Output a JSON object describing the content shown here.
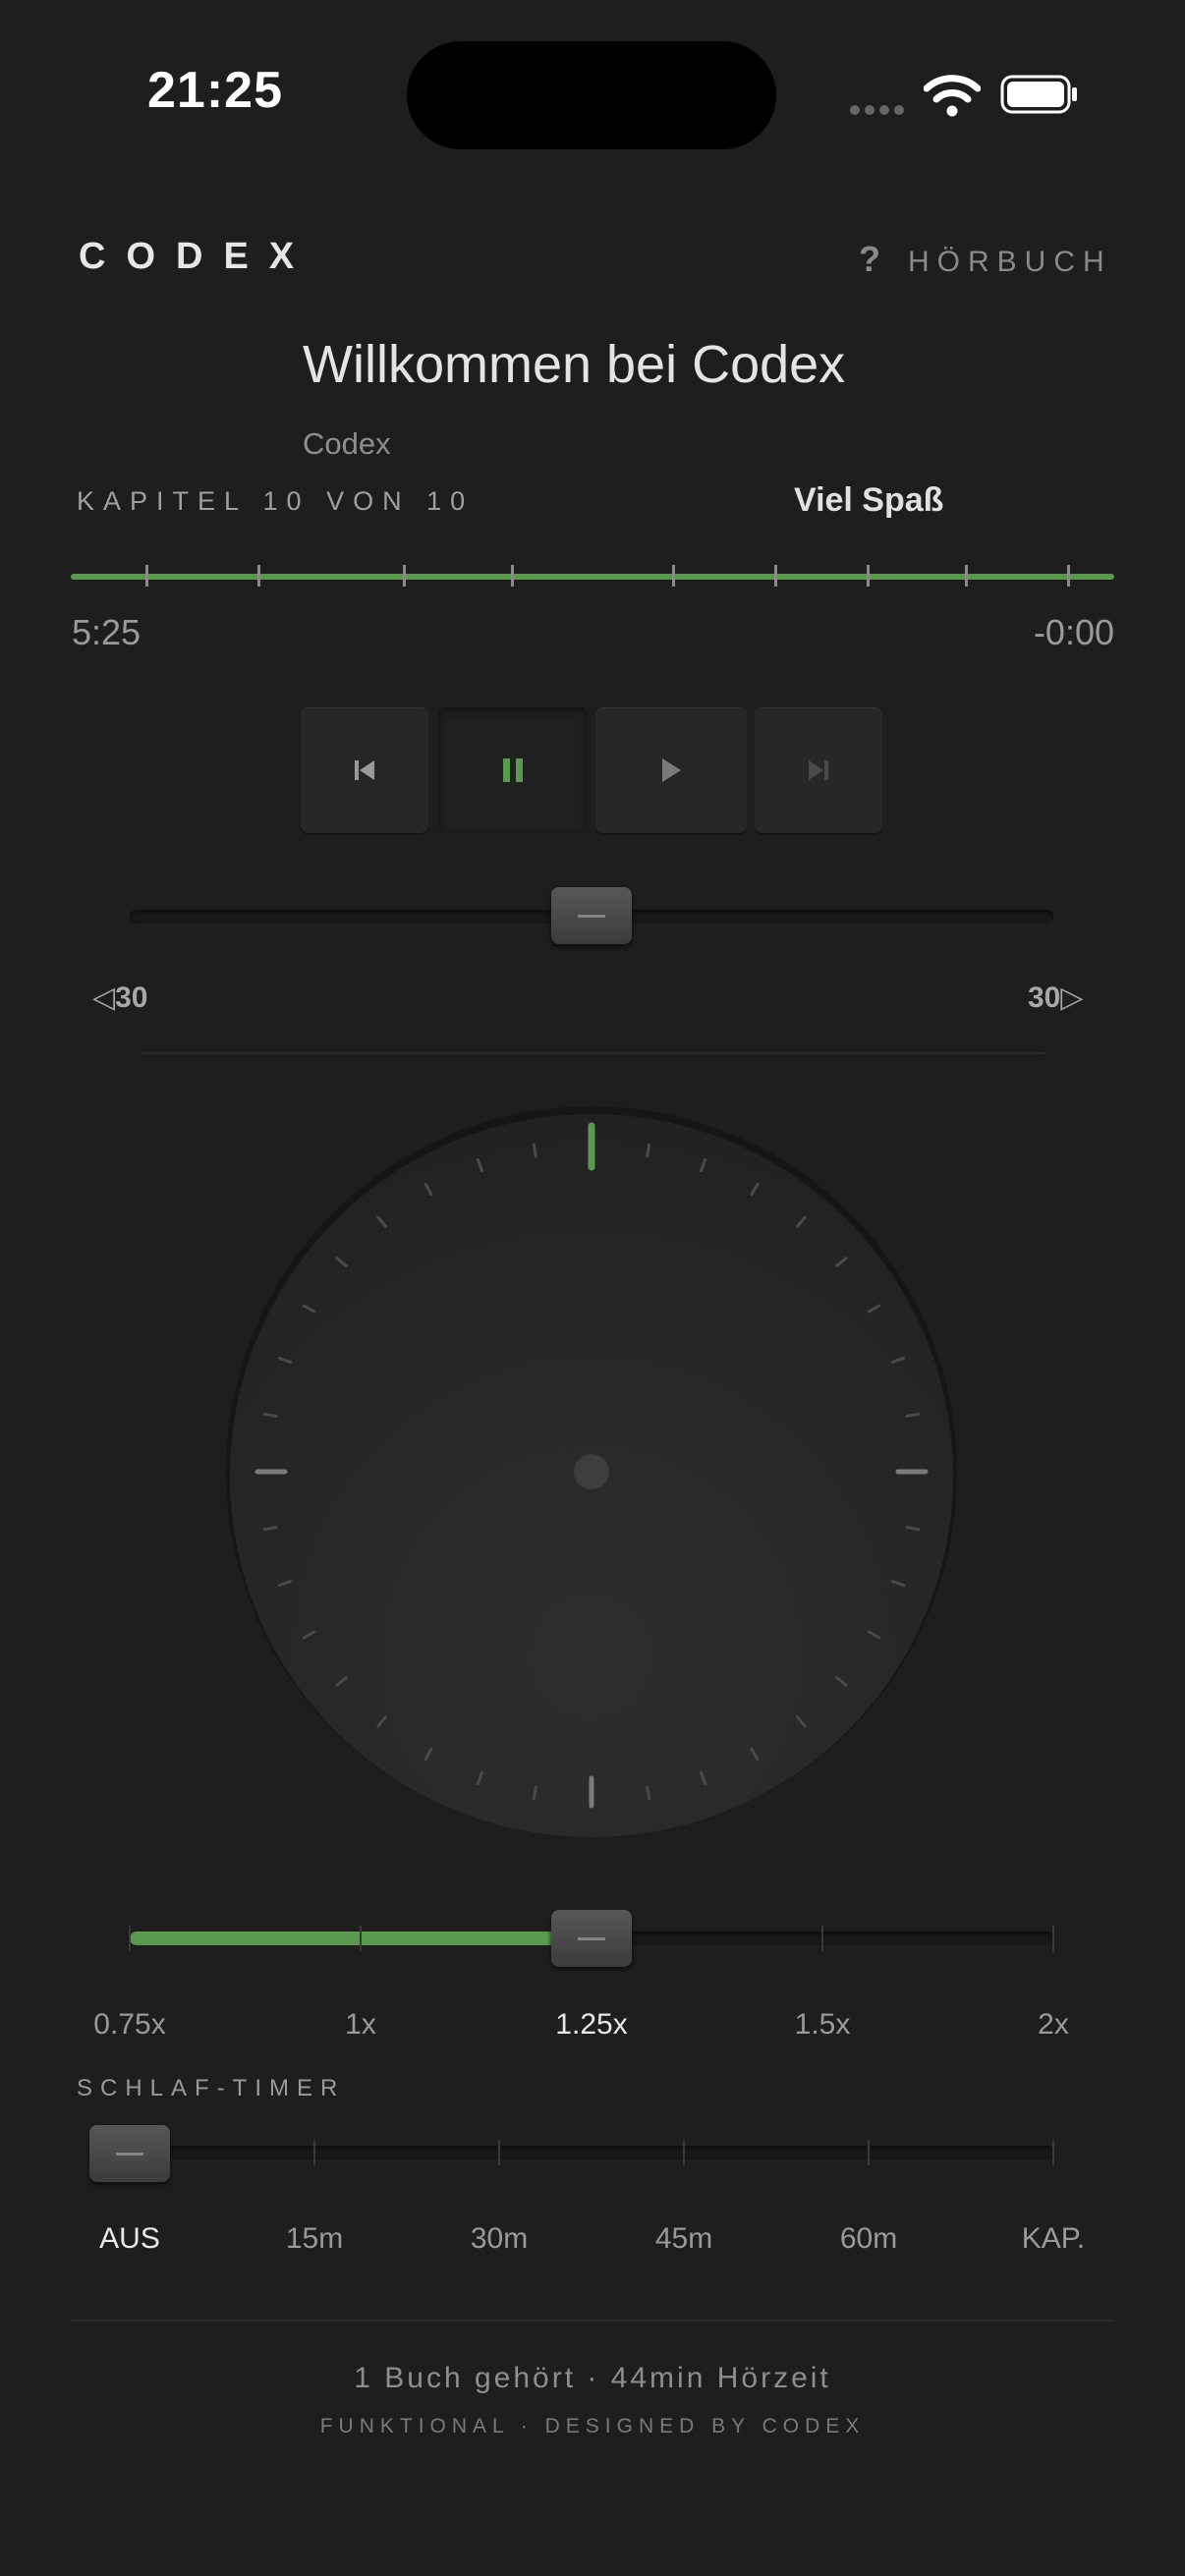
{
  "status_bar": {
    "time": "21:25"
  },
  "header": {
    "brand": "CODEX",
    "help": "?",
    "audiobook": "HÖRBUCH"
  },
  "book": {
    "title": "Willkommen bei Codex",
    "author": "Codex",
    "chapter_label": "KAPITEL 10 VON 10",
    "chapter_title": "Viel Spaß"
  },
  "progress": {
    "elapsed": "5:25",
    "remaining": "-0:00",
    "fraction": 1.0
  },
  "transport": {
    "buttons": [
      {
        "name": "previous-chapter",
        "icon": "skip-back-icon"
      },
      {
        "name": "pause",
        "icon": "pause-icon",
        "active": true
      },
      {
        "name": "play",
        "icon": "play-icon"
      },
      {
        "name": "next-chapter",
        "icon": "skip-forward-icon"
      }
    ]
  },
  "skip": {
    "back_label": "◁30",
    "forward_label": "30▷",
    "position": 0.5
  },
  "speed": {
    "options": [
      "0.75x",
      "1x",
      "1.25x",
      "1.5x",
      "2x"
    ],
    "selected_index": 2
  },
  "sleep_timer": {
    "title": "SCHLAF-TIMER",
    "options": [
      "AUS",
      "15m",
      "30m",
      "45m",
      "60m",
      "KAP."
    ],
    "selected_index": 0
  },
  "footer": {
    "stats": "1 Buch gehört · 44min Hörzeit",
    "credit": "FUNKTIONAL · DESIGNED BY CODEX"
  },
  "colors": {
    "accent": "#5a9a4e",
    "background": "#1e1e1e"
  }
}
